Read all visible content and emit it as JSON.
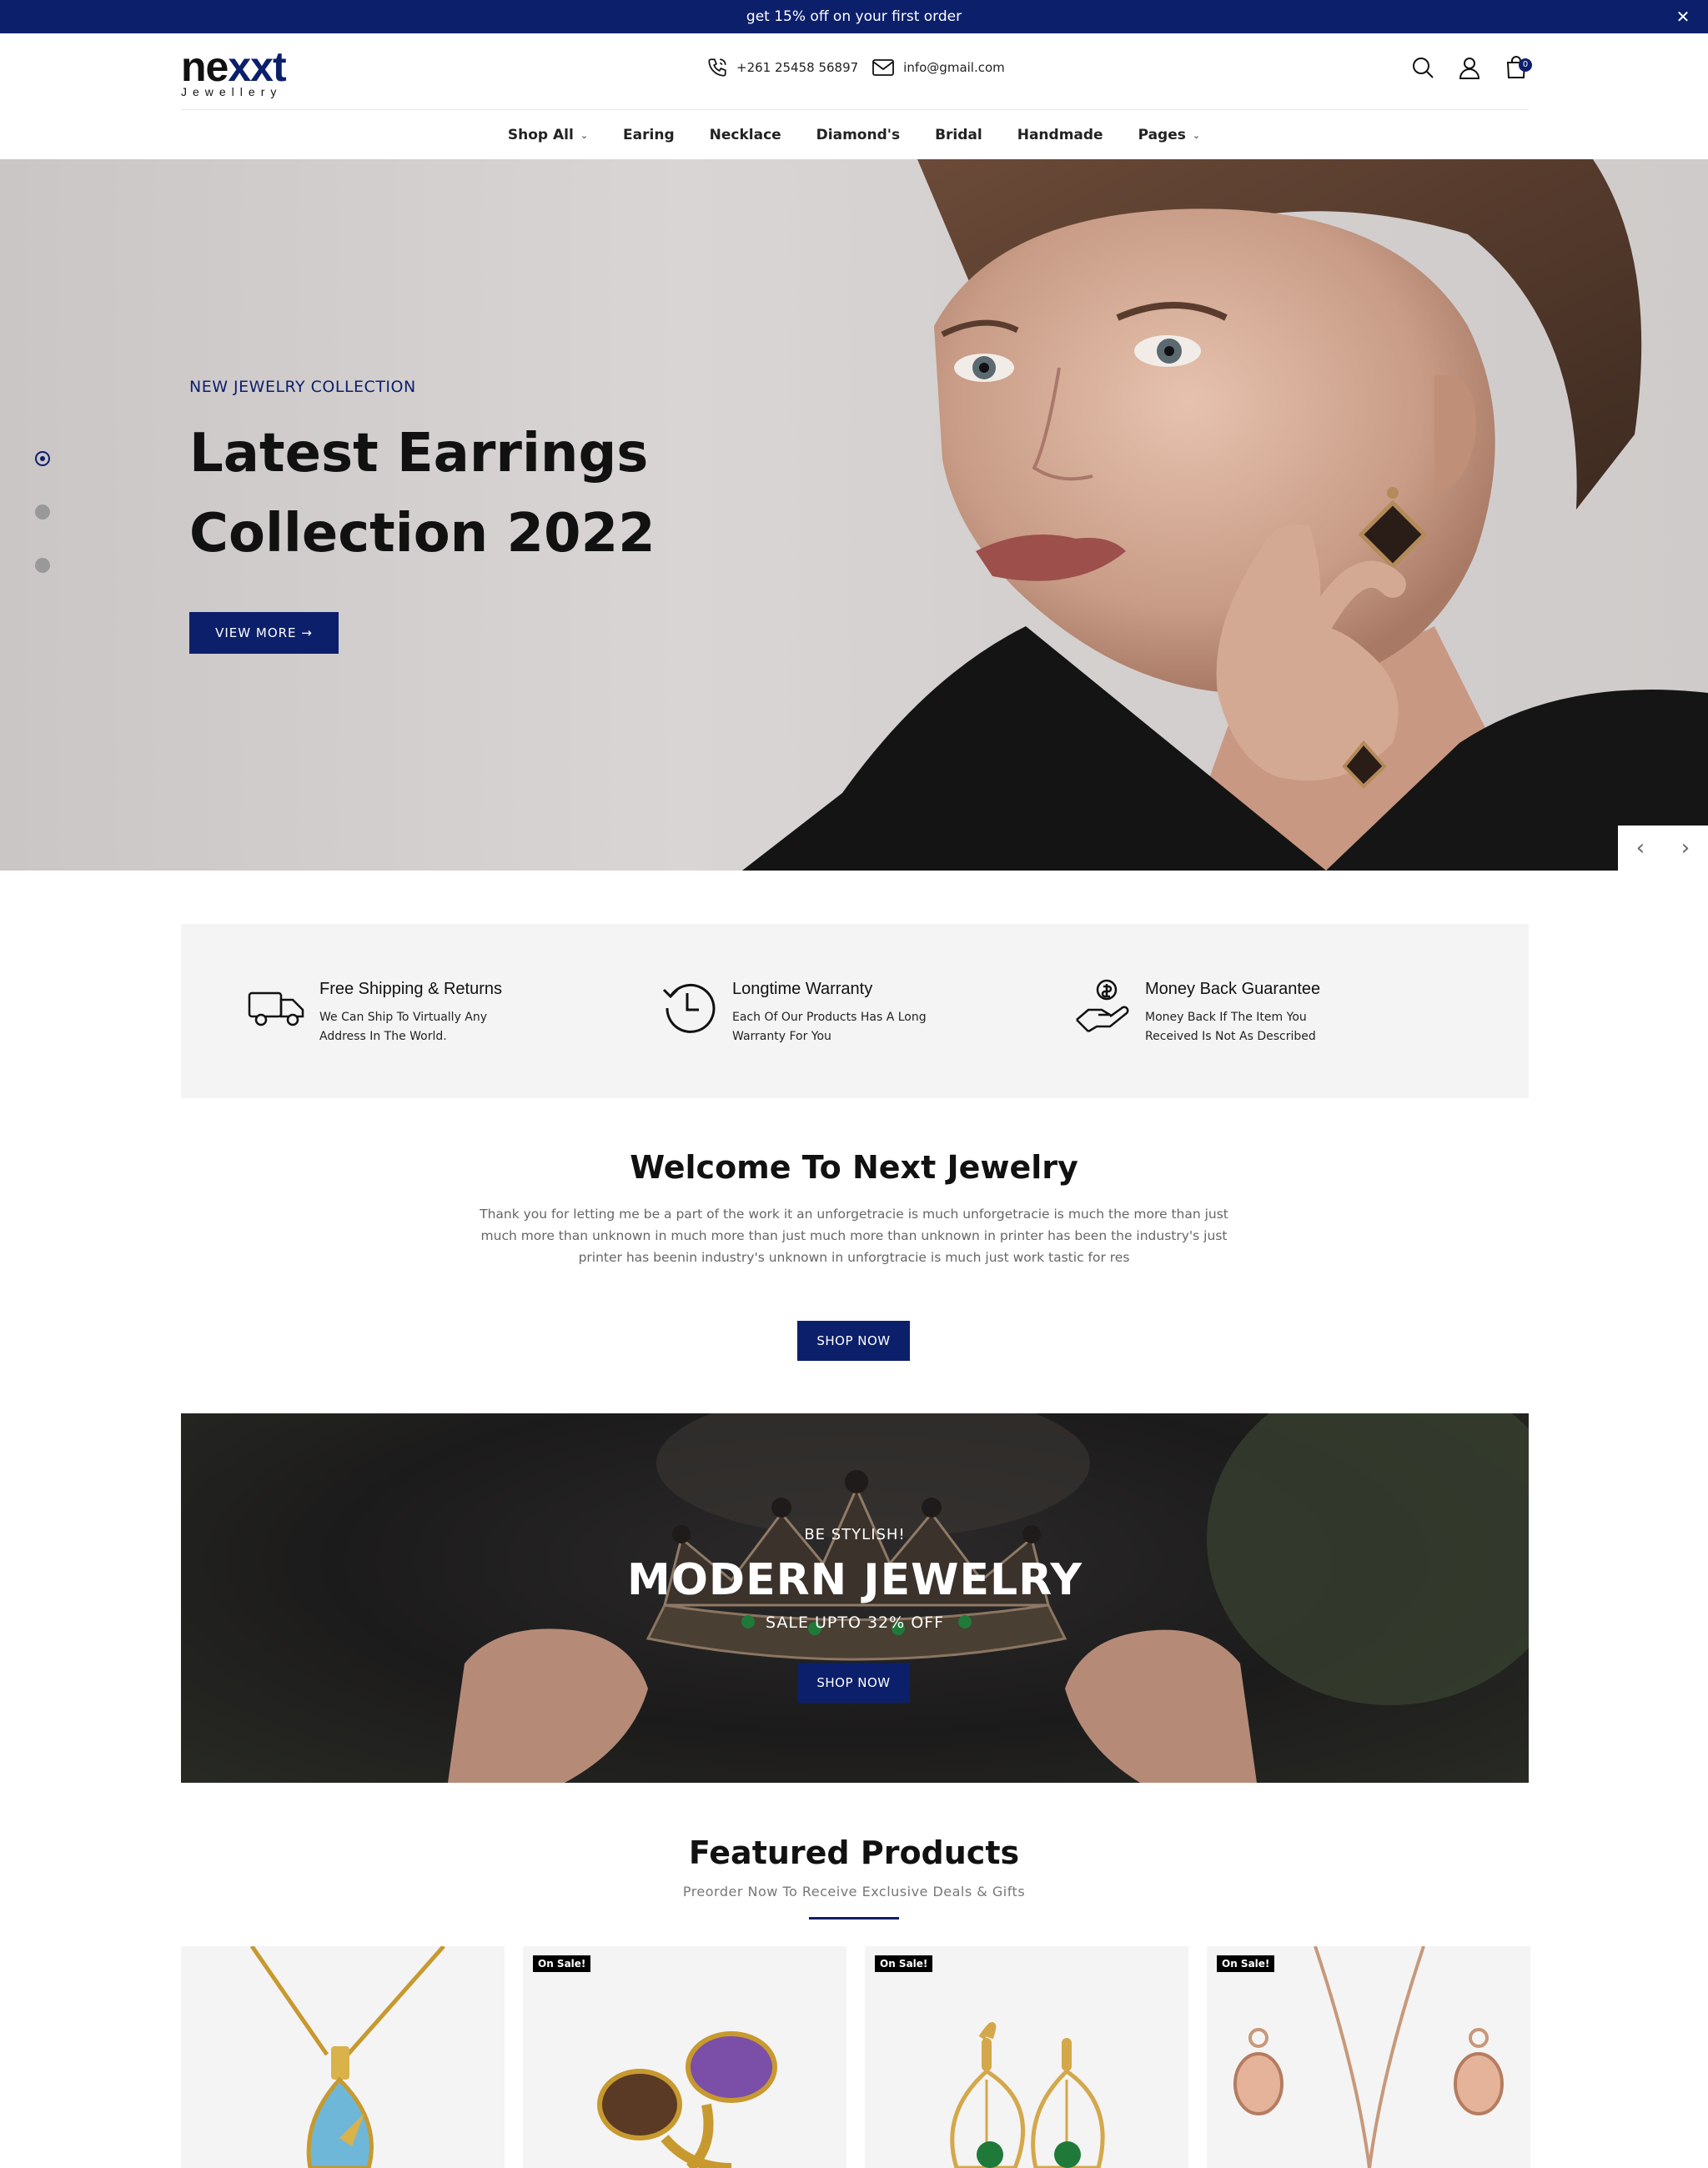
{
  "announcement": {
    "text": "get 15% off on your first order"
  },
  "brand": {
    "name_prefix": "ne",
    "name_mark": "xxt",
    "tagline": "Jewellery",
    "accent": "#0c1f6b"
  },
  "contact": {
    "phone": "+261 25458 56897",
    "email": "info@gmail.com"
  },
  "header_icons": [
    "search-icon",
    "user-icon",
    "cart-icon"
  ],
  "cart": {
    "count": "0"
  },
  "nav": {
    "items": [
      {
        "label": "Shop All",
        "dropdown": true
      },
      {
        "label": "Earing",
        "dropdown": false
      },
      {
        "label": "Necklace",
        "dropdown": false
      },
      {
        "label": "Diamond's",
        "dropdown": false
      },
      {
        "label": "Bridal",
        "dropdown": false
      },
      {
        "label": "Handmade",
        "dropdown": false
      },
      {
        "label": "Pages",
        "dropdown": true
      }
    ]
  },
  "hero": {
    "kicker": "NEW JEWELRY COLLECTION",
    "title": "Latest Earrings Collection 2022",
    "button": "VIEW MORE →",
    "slides": 3,
    "active_slide": 1
  },
  "features": [
    {
      "title": "Free Shipping & Returns",
      "desc": "We Can Ship To Virtually Any Address In The World.",
      "icon": "truck-icon"
    },
    {
      "title": "Longtime Warranty",
      "desc": "Each Of Our Products Has A Long Warranty For You",
      "icon": "clock-history-icon"
    },
    {
      "title": "Money Back Guarantee",
      "desc": "Money Back If The Item You Received Is Not As Described",
      "icon": "money-hand-icon"
    }
  ],
  "welcome": {
    "title": "Welcome To Next Jewelry",
    "text": "Thank you for letting me be a part of the work it an unforgetracie is much unforgetracie is much the more than just much more than unknown in much more than just much more than unknown in printer has been the industry's just printer has beenin industry's unknown in unforgtracie is much just work tastic for res",
    "button": "SHOP NOW"
  },
  "banner": {
    "kicker": "BE STYLISH!",
    "title": "MODERN JEWELRY",
    "subtitle": "SALE UPTO 32% OFF",
    "button": "SHOP NOW"
  },
  "featured": {
    "title": "Featured Products",
    "subtitle": "Preorder Now To Receive Exclusive Deals & Gifts",
    "products": [
      {
        "badge": ""
      },
      {
        "badge": "On Sale!"
      },
      {
        "badge": "On Sale!"
      },
      {
        "badge": "On Sale!"
      }
    ]
  }
}
